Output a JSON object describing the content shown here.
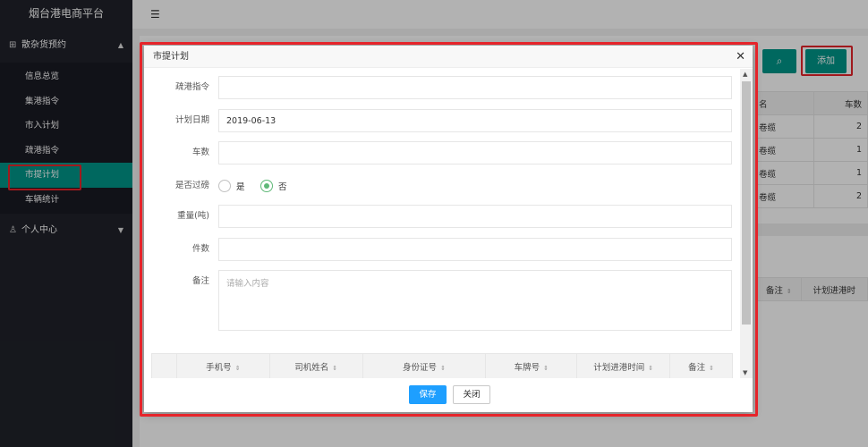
{
  "app": {
    "title": "烟台港电商平台"
  },
  "sidebar": {
    "groups": [
      {
        "label": "散杂货预约",
        "items": [
          {
            "label": "信息总览"
          },
          {
            "label": "集港指令"
          },
          {
            "label": "市入计划"
          },
          {
            "label": "疏港指令"
          },
          {
            "label": "市提计划"
          },
          {
            "label": "车辆统计"
          }
        ]
      },
      {
        "label": "个人中心"
      }
    ]
  },
  "toolbar": {
    "add_label": "添加"
  },
  "bg_table": {
    "header": [
      "名",
      "车数"
    ],
    "rows": [
      [
        "卷缆",
        "2"
      ],
      [
        "卷缆",
        "1"
      ],
      [
        "卷缆",
        "1"
      ],
      [
        "卷缆",
        "2"
      ]
    ],
    "header2": [
      "备注",
      "计划进港时"
    ]
  },
  "modal": {
    "title": "市提计划",
    "form": {
      "dredge_order": {
        "label": "疏港指令",
        "value": ""
      },
      "plan_date": {
        "label": "计划日期",
        "value": "2019-06-13"
      },
      "car_count": {
        "label": "车数",
        "value": ""
      },
      "weigh": {
        "label": "是否过磅",
        "options": [
          "是",
          "否"
        ],
        "selected": "否"
      },
      "weight": {
        "label": "重量(吨)",
        "value": ""
      },
      "pieces": {
        "label": "件数",
        "value": ""
      },
      "remark": {
        "label": "备注",
        "placeholder": "请输入内容"
      }
    },
    "table_headers": [
      "手机号",
      "司机姓名",
      "身份证号",
      "车牌号",
      "计划进港时间",
      "备注"
    ],
    "save_label": "保存",
    "close_label": "关闭"
  },
  "colors": {
    "sidebar_bg": "#20222a",
    "active": "#009688",
    "primary_blue": "#1e9fff",
    "highlight_red": "#e6242a"
  }
}
